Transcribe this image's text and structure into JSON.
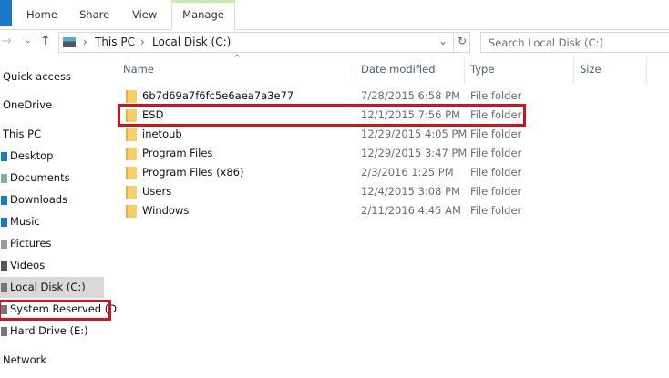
{
  "ribbon": {
    "tabs": [
      "Home",
      "Share",
      "View"
    ],
    "active_tab": "Manage"
  },
  "address": {
    "path": [
      "This PC",
      "Local Disk (C:)"
    ]
  },
  "search": {
    "placeholder": "Search Local Disk (C:)"
  },
  "columns": {
    "name": "Name",
    "date": "Date modified",
    "type": "Type",
    "size": "Size"
  },
  "files": [
    {
      "name": "6b7d69a7f6fc5e6aea7a3e77",
      "date": "7/28/2015 6:58 PM",
      "type": "File folder"
    },
    {
      "name": "ESD",
      "date": "12/1/2015 7:56 PM",
      "type": "File folder"
    },
    {
      "name": "inetoub",
      "date": "12/29/2015 4:05 PM",
      "type": "File folder"
    },
    {
      "name": "Program Files",
      "date": "12/29/2015 3:47 PM",
      "type": "File folder"
    },
    {
      "name": "Program Files (x86)",
      "date": "2/3/2016 1:25 PM",
      "type": "File folder"
    },
    {
      "name": "Users",
      "date": "12/4/2015 3:08 PM",
      "type": "File folder"
    },
    {
      "name": "Windows",
      "date": "2/11/2016 4:45 AM",
      "type": "File folder"
    }
  ],
  "nav": {
    "quick_access": "Quick access",
    "onedrive": "OneDrive",
    "this_pc": "This PC",
    "items": [
      "Desktop",
      "Documents",
      "Downloads",
      "Music",
      "Pictures",
      "Videos",
      "Local Disk (C:)",
      "System Reserved (D",
      "Hard Drive (E:)"
    ],
    "network": "Network"
  },
  "colors": {
    "highlight": "#d1141b",
    "selected_nav": "#d9d9d9",
    "accent": "#1979ca"
  }
}
